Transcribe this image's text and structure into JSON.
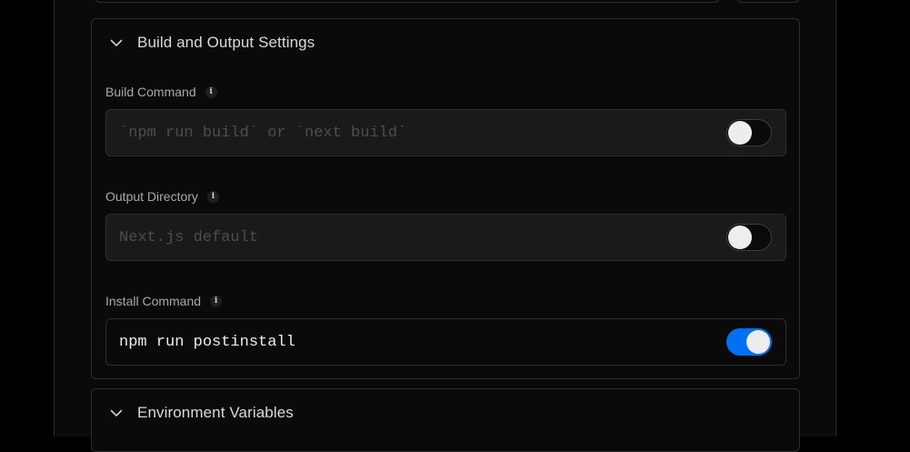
{
  "build_settings": {
    "title": "Build and Output Settings",
    "fields": [
      {
        "label": "Build Command",
        "placeholder": "`npm run build` or `next build`",
        "value": "",
        "override_enabled": false
      },
      {
        "label": "Output Directory",
        "placeholder": "Next.js default",
        "value": "",
        "override_enabled": false
      },
      {
        "label": "Install Command",
        "placeholder": "",
        "value": "npm run postinstall",
        "override_enabled": true
      }
    ]
  },
  "environment_variables": {
    "title": "Environment Variables"
  },
  "icons": {
    "collapse": "chevron-down-icon",
    "info": "info-icon"
  },
  "colors": {
    "toggle_on": "#0070f3",
    "background": "#0a0a0a",
    "border": "#2e2e2e"
  }
}
